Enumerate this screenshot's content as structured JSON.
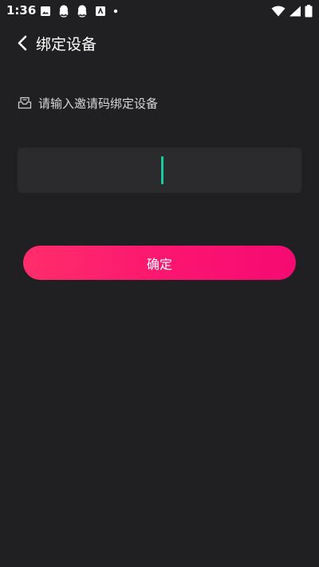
{
  "status_bar": {
    "time": "1:36",
    "left_icons": [
      "image-icon",
      "qq-icon",
      "qq-icon",
      "sim-app-icon",
      "dot-icon"
    ],
    "right_icons": [
      "wifi-icon",
      "signal-icon",
      "battery-icon"
    ]
  },
  "header": {
    "back_icon": "chevron-left-icon",
    "title": "绑定设备"
  },
  "prompt": {
    "icon": "inbox-icon",
    "text": "请输入邀请码绑定设备"
  },
  "code_input": {
    "value": "",
    "caret_color": "#1cc8a0"
  },
  "confirm_button": {
    "label": "确定",
    "gradient_start": "#ff2d6b",
    "gradient_end": "#f60a72"
  },
  "colors": {
    "background": "#202022",
    "input_background": "#2b2b2d"
  }
}
